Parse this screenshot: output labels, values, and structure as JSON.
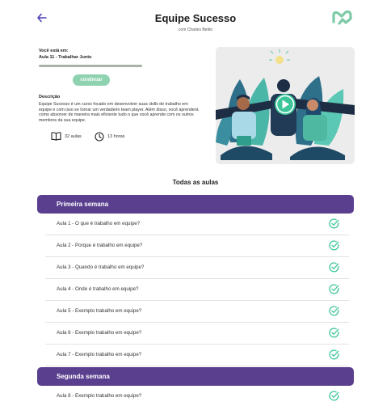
{
  "header": {
    "title": "Equipe Sucesso",
    "subtitle": "com Charles Betito"
  },
  "current": {
    "label": "Você está em:",
    "lesson": "Aula 11 - Trabalhar Junto",
    "progress_fraction": 1.0,
    "continue_label": "continuar"
  },
  "description": {
    "title": "Descrição",
    "text": "Equipe Sucesso é um curso focado em desenvolver suas skills de trabalho em equipe e com isso se tornar um verdadeiro team player. Além disso, você aprenderá como absorver de maneira mais eficiente tudo o que você aprende com os outros membros da sua equipe."
  },
  "meta": {
    "lessons": "32 aulas",
    "hours": "13 horas"
  },
  "lessons_heading": "Todas as aulas",
  "weeks": [
    {
      "title": "Primeira semana"
    },
    {
      "title": "Segunda semana"
    }
  ],
  "lessons": [
    {
      "label": "Aula 1 - O que é trabalho em equipe?"
    },
    {
      "label": "Aula 2 - Porque é trabalho em equipe?"
    },
    {
      "label": "Aula 3 - Quando é trabalho em equipe?"
    },
    {
      "label": "Aula 4 - Onde é trabalho em equipe?"
    },
    {
      "label": "Aula 5 - Exemplo trabalho em equipe?"
    },
    {
      "label": "Aula 6 - Exemplo trabalho em equipe?"
    },
    {
      "label": "Aula 7 - Exemplo trabalho em equipe?"
    },
    {
      "label": "Aula 8 - Exemplo trabalho em equipe?"
    }
  ],
  "colors": {
    "accent_purple": "#5a3f8f",
    "accent_green": "#8ed2b0",
    "check_green": "#3cc59a",
    "teal": "#2aa18c"
  },
  "icons": {
    "back": "arrow-left-icon",
    "logo": "brand-logo",
    "book": "book-icon",
    "clock": "clock-icon",
    "play": "play-icon",
    "check": "check-circle-icon"
  }
}
